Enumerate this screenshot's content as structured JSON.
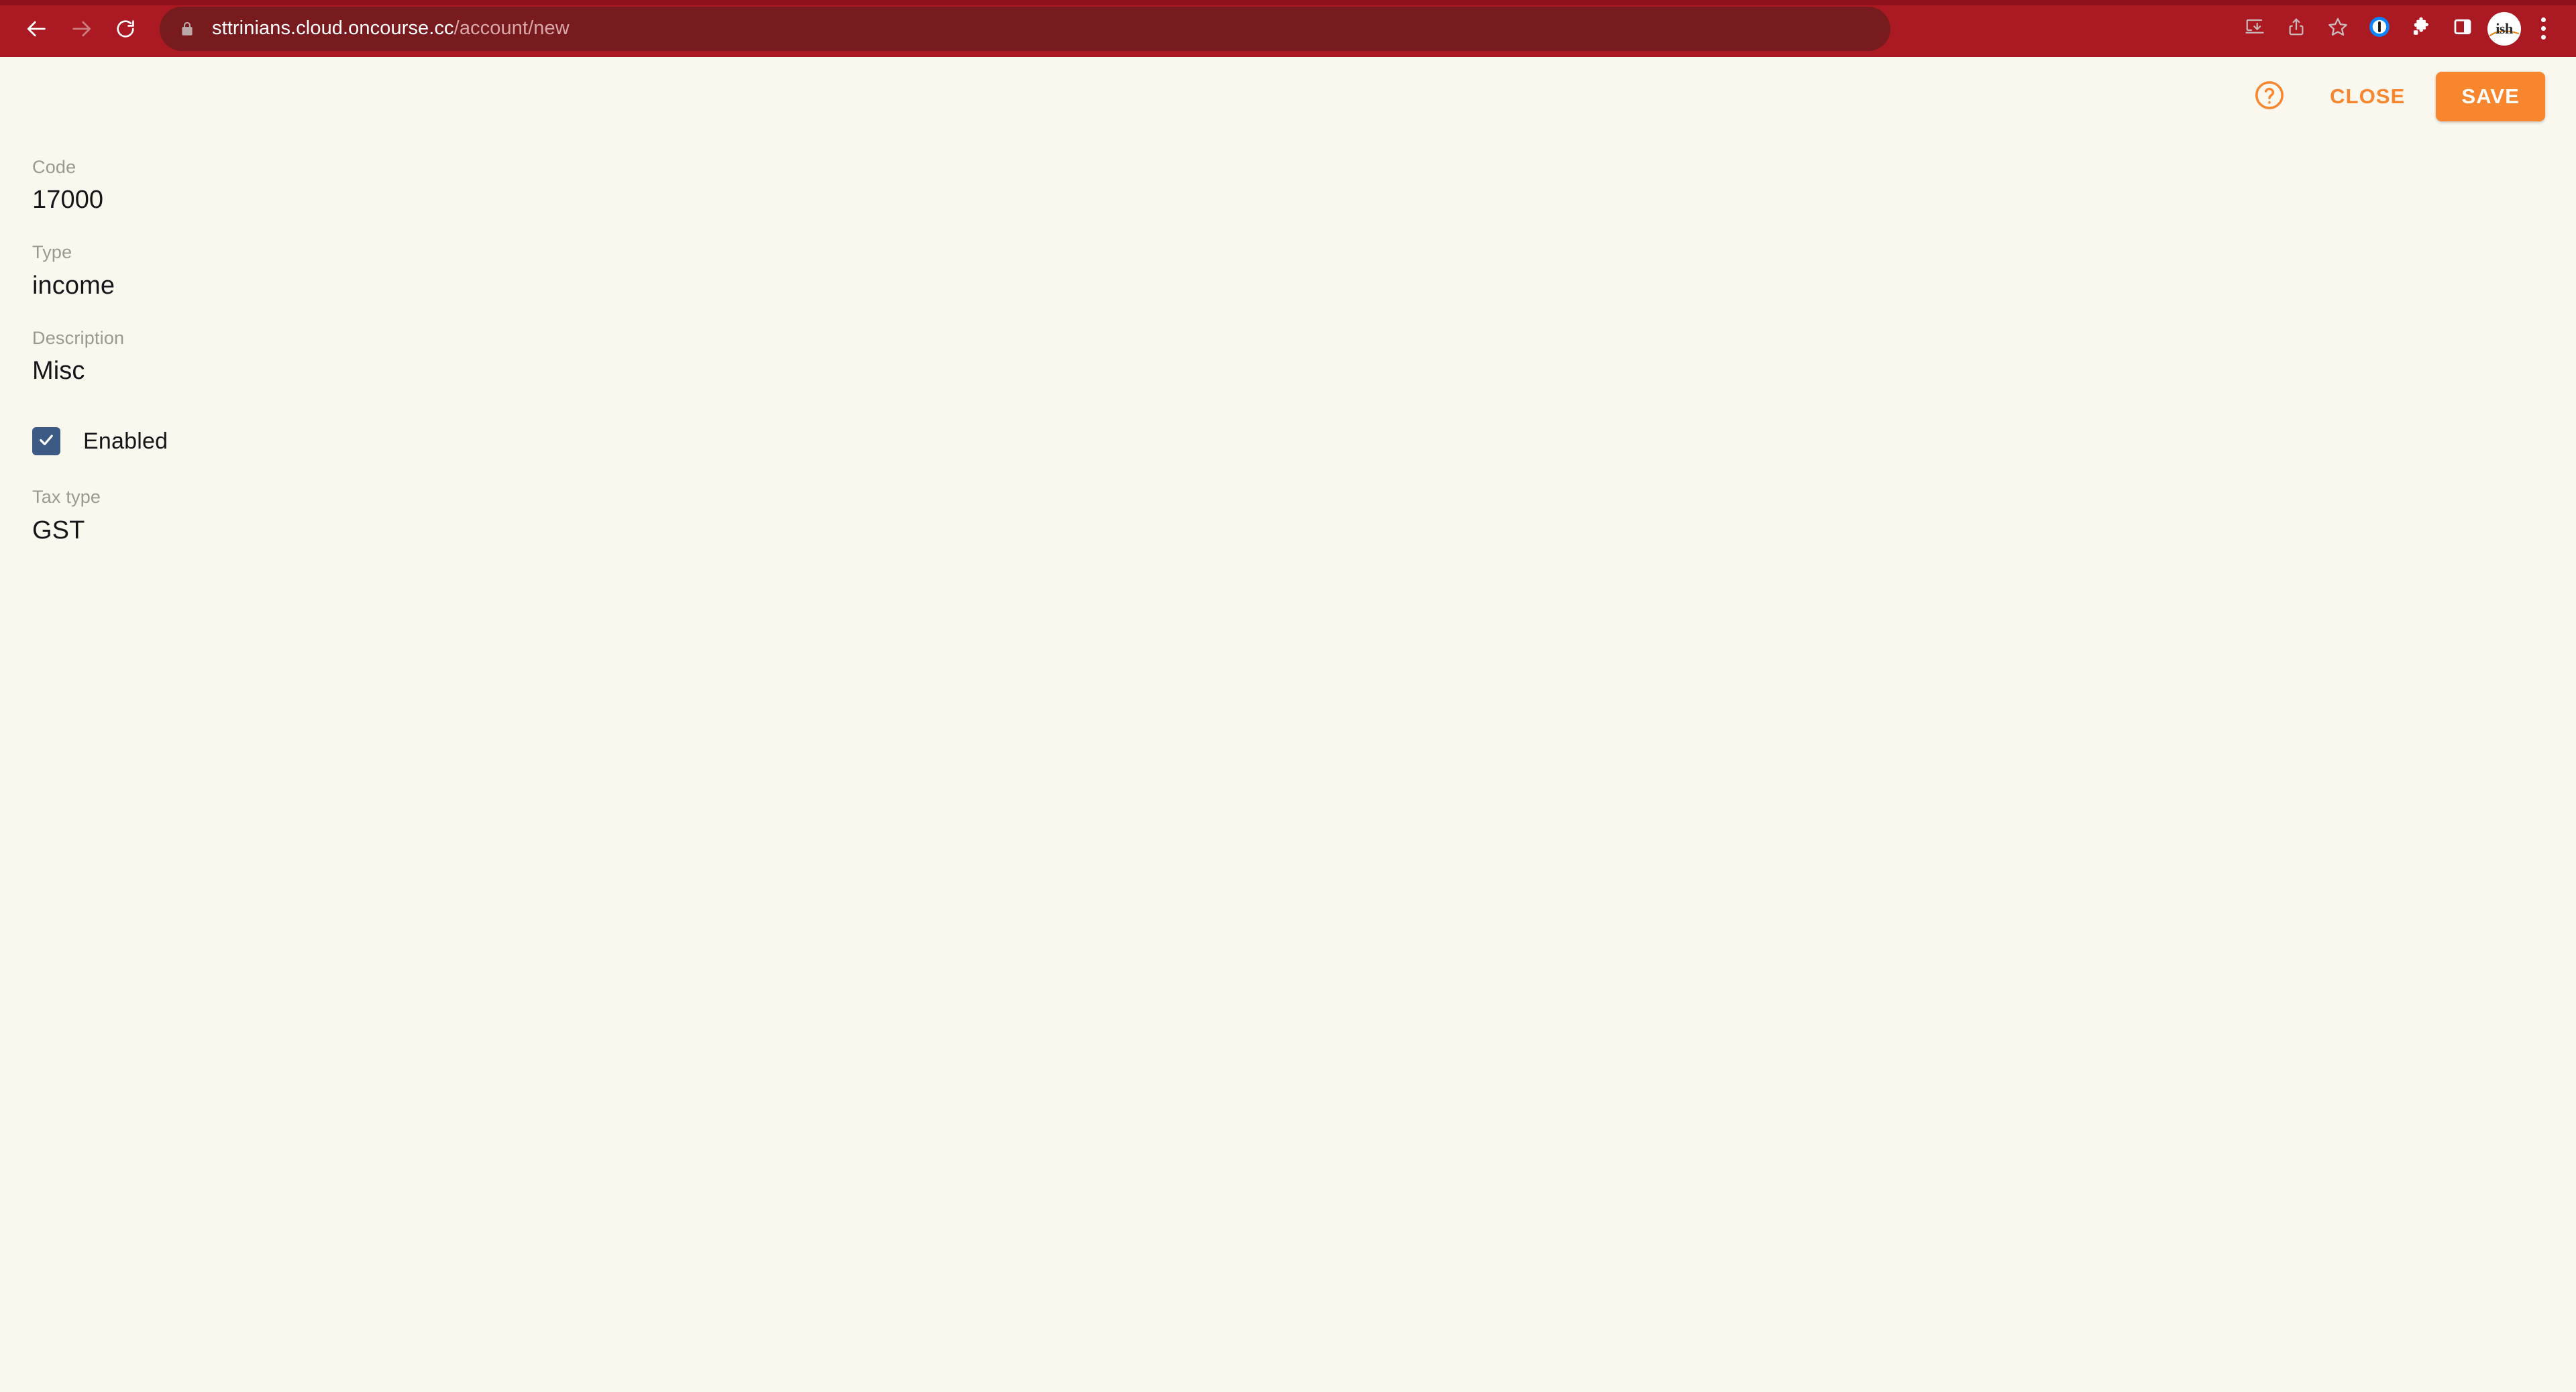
{
  "browser": {
    "nav": {
      "back_icon": "arrow-left-icon",
      "forward_icon": "arrow-right-icon",
      "reload_icon": "reload-icon"
    },
    "omnibox": {
      "lock_icon": "lock-icon",
      "url_host": "sttrinians.cloud.oncourse.cc",
      "url_path": "/account/new",
      "full_url": "sttrinians.cloud.oncourse.cc/account/new"
    },
    "actions": [
      {
        "name": "install-app-icon",
        "title": "Install app"
      },
      {
        "name": "share-icon",
        "title": "Share this page"
      },
      {
        "name": "bookmark-star-icon",
        "title": "Bookmark this tab"
      },
      {
        "name": "onepassword-icon",
        "title": "1Password"
      },
      {
        "name": "extensions-puzzle-icon",
        "title": "Extensions"
      },
      {
        "name": "side-panel-icon",
        "title": "Side panel"
      }
    ],
    "profile": {
      "avatar_text": "ish",
      "title": "Profile"
    },
    "menu_icon": "kebab-menu-icon",
    "colors": {
      "toolbar_bg": "#ab1a22",
      "toolbar_top_band": "#8e1119",
      "omnibox_bg": "#771b1f",
      "url_host_color": "#ffffff",
      "url_path_color": "#d9a7a9"
    }
  },
  "app": {
    "header": {
      "help_icon": "help-circle-icon",
      "close_label": "CLOSE",
      "save_label": "SAVE"
    },
    "form": {
      "fields": [
        {
          "label": "Code",
          "value": "17000"
        },
        {
          "label": "Type",
          "value": "income"
        },
        {
          "label": "Description",
          "value": "Misc"
        }
      ],
      "checkbox": {
        "label": "Enabled",
        "checked": true,
        "check_icon": "checkmark-icon"
      },
      "tax_field": {
        "label": "Tax type",
        "value": "GST"
      }
    },
    "colors": {
      "page_bg": "#faf8ee",
      "accent_orange": "#f7862f",
      "checkbox_blue": "#3d5a85",
      "label_gray": "#9b9890",
      "value_dark": "#16161a"
    }
  }
}
